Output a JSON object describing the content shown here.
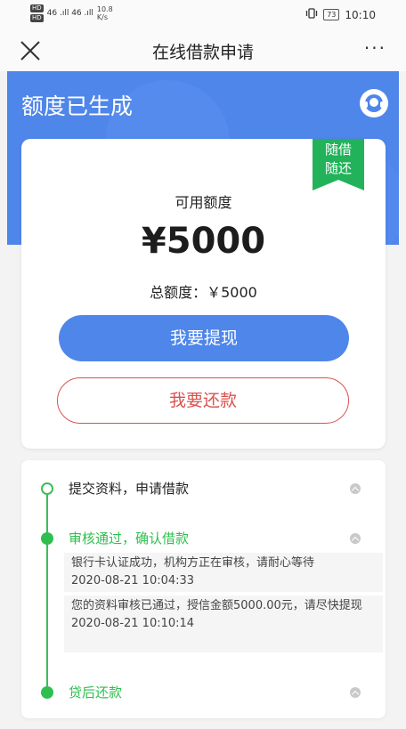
{
  "status_bar": {
    "network_badges": [
      "HD",
      "HD"
    ],
    "signal_text": "46 .ıll 46 .ıll",
    "speed_value": "10.8",
    "speed_unit": "K/s",
    "vibrate_icon": "vibrate-icon",
    "battery": "73",
    "time": "10:10"
  },
  "nav": {
    "title": "在线借款申请",
    "close_icon": "close-icon",
    "more": "···"
  },
  "hero": {
    "title": "额度已生成",
    "service_icon": "customer-service-icon",
    "color": "#4f86ea"
  },
  "card": {
    "ribbon": [
      "随借",
      "随还"
    ],
    "available_label": "可用额度",
    "available_amount": "¥5000",
    "total_label": "总额度：￥5000",
    "withdraw_button": "我要提现",
    "repay_button": "我要还款"
  },
  "steps": [
    {
      "label": "提交资料，申请借款",
      "state": "done"
    },
    {
      "label": "审核通过，确认借款",
      "state": "active",
      "details": [
        {
          "text": "银行卡认证成功，机构方正在审核，请耐心等待",
          "time": "2020-08-21 10:04:33"
        },
        {
          "text": "您的资料审核已通过，授信金额5000.00元，请尽快提现",
          "time": "2020-08-21 10:10:14"
        }
      ]
    },
    {
      "label": "贷后还款",
      "state": "active"
    }
  ],
  "colors": {
    "primary": "#4f86ea",
    "success": "#2fbf4f",
    "danger": "#d9534f"
  }
}
